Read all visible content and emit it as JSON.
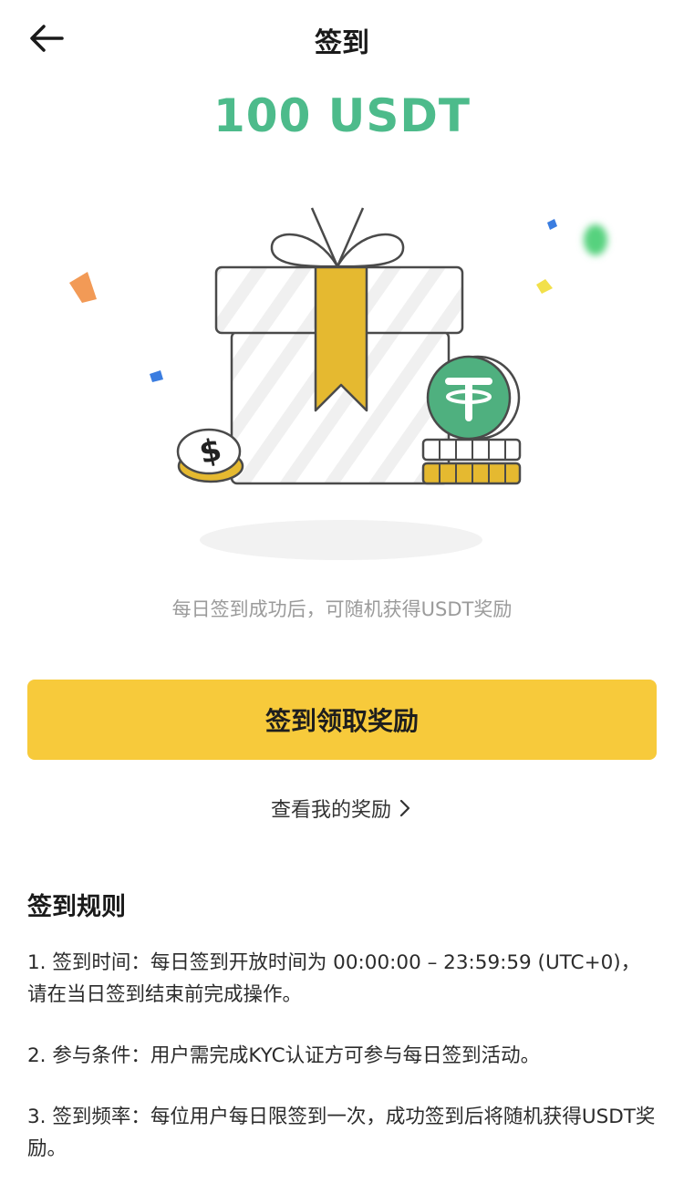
{
  "header": {
    "title": "签到",
    "back_icon": "arrow-left-icon"
  },
  "reward": {
    "amount": "100 USDT",
    "color": "#4dbb8b"
  },
  "illustration": {
    "icons": [
      "gift-box-icon",
      "tether-coin-icon",
      "dollar-coin-icon",
      "coin-stack-icon",
      "confetti-icon"
    ],
    "coin_symbol": "$"
  },
  "subtitle": "每日签到成功后，可随机获得USDT奖励",
  "actions": {
    "claim_label": "签到领取奖励",
    "claim_color": "#f7ca3b",
    "view_rewards_label": "查看我的奖励",
    "view_rewards_icon": "chevron-right-icon"
  },
  "rules": {
    "title": "签到规则",
    "items": [
      "1. 签到时间：每日签到开放时间为 00:00:00 – 23:59:59 (UTC+0)，请在当日签到结束前完成操作。",
      "2. 参与条件：用户需完成KYC认证方可参与每日签到活动。",
      "3. 签到频率：每位用户每日限签到一次，成功签到后将随机获得USDT奖励。"
    ]
  }
}
